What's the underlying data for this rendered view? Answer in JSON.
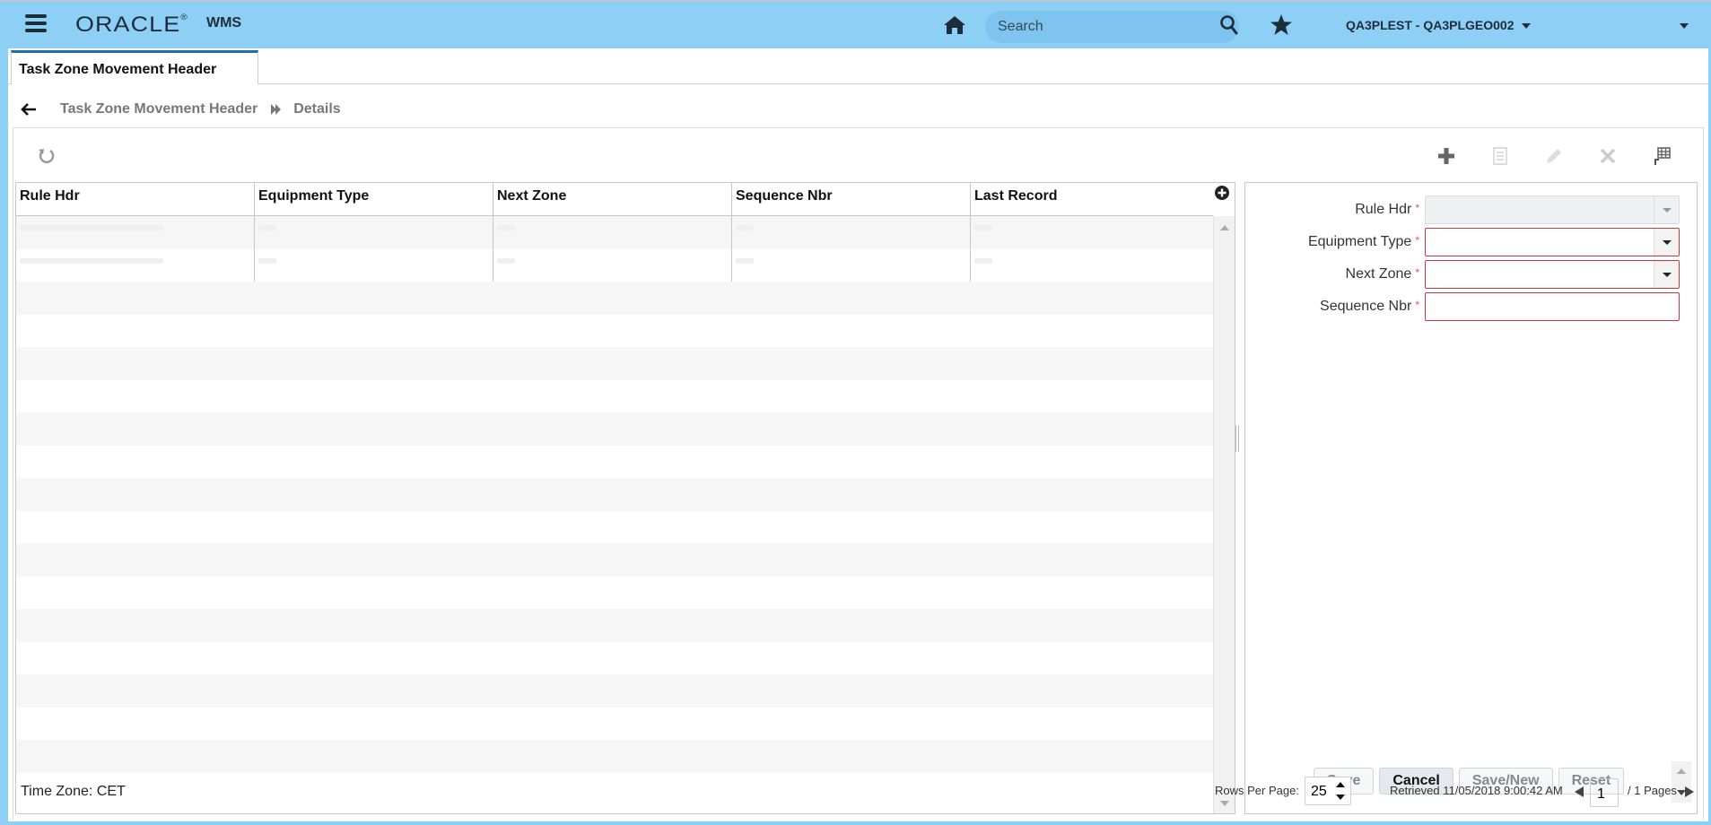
{
  "header": {
    "brand": "ORACLE",
    "app_name": "WMS",
    "search_placeholder": "Search",
    "facility_company": "QA3PLEST - QA3PLGEO002",
    "icons": [
      "menu-icon",
      "home-icon",
      "search-icon",
      "star-icon"
    ]
  },
  "tabs": [
    {
      "label": "Task Zone Movement Header",
      "active": true
    }
  ],
  "breadcrumb": {
    "parent": "Task Zone Movement Header",
    "current": "Details"
  },
  "toolbar": {
    "left": [
      "refresh-icon"
    ],
    "right": [
      "add-icon",
      "copy-icon",
      "edit-icon",
      "delete-icon",
      "export-grid-icon"
    ]
  },
  "grid": {
    "columns": [
      "Rule Hdr",
      "Equipment Type",
      "Next Zone",
      "Sequence Nbr",
      "Last Record"
    ],
    "rows_with_faded_data": 2,
    "visible_row_count": 17
  },
  "form": {
    "fields": [
      {
        "label": "Rule Hdr",
        "required": true,
        "type": "dropdown",
        "disabled": true,
        "value": ""
      },
      {
        "label": "Equipment Type",
        "required": true,
        "type": "dropdown",
        "disabled": false,
        "value": ""
      },
      {
        "label": "Next Zone",
        "required": true,
        "type": "dropdown",
        "disabled": false,
        "value": ""
      },
      {
        "label": "Sequence Nbr",
        "required": true,
        "type": "text",
        "disabled": false,
        "value": ""
      }
    ],
    "required_marker": "*",
    "buttons": {
      "save": "Save",
      "cancel": "Cancel",
      "save_new": "Save/New",
      "reset": "Reset"
    }
  },
  "footer": {
    "timezone": "Time Zone: CET",
    "rows_per_page_label": "Rows Per Page:",
    "rows_per_page": "25",
    "retrieved": "Retrieved 11/05/2018 9:00:42 AM",
    "current_page": "1",
    "total_pages": "/ 1 Pages"
  },
  "colors": {
    "header_bg": "#8ecff6",
    "tab_accent": "#1e6fab",
    "required_border": "#d3333d"
  }
}
